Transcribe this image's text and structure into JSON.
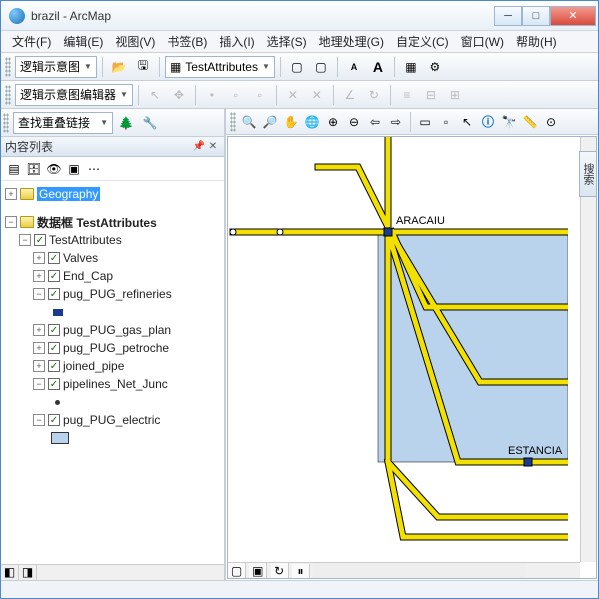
{
  "window": {
    "title": "brazil - ArcMap"
  },
  "menu": {
    "file": "文件(F)",
    "edit": "编辑(E)",
    "view": "视图(V)",
    "bookmarks": "书签(B)",
    "insert": "插入(I)",
    "select": "选择(S)",
    "geoproc": "地理处理(G)",
    "customize": "自定义(C)",
    "window": "窗口(W)",
    "help": "帮助(H)"
  },
  "tb1": {
    "schematic_label": "逻辑示意图",
    "combo": "TestAttributes"
  },
  "tb2": {
    "editor_label": "逻辑示意图编辑器"
  },
  "tb3": {
    "find_label": "查找重叠链接"
  },
  "toc": {
    "title": "内容列表",
    "geography": "Geography",
    "df_label": "数据框 TestAttributes",
    "group": "TestAttributes",
    "layers": {
      "valves": "Valves",
      "endcap": "End_Cap",
      "refineries": "pug_PUG_refineries",
      "gas": "pug_PUG_gas_plan",
      "petro": "pug_PUG_petroche",
      "joined": "joined_pipe",
      "junc": "pipelines_Net_Junc",
      "electric": "pug_PUG_electric"
    }
  },
  "map": {
    "labels": {
      "aracaiu": "ARACAIU",
      "estancia": "ESTANCIA"
    }
  },
  "side_tab": "搜索",
  "colors": {
    "pipe_fill": "#f2e100",
    "pipe_stroke": "#000",
    "sel_region": "#b9d3ec"
  }
}
